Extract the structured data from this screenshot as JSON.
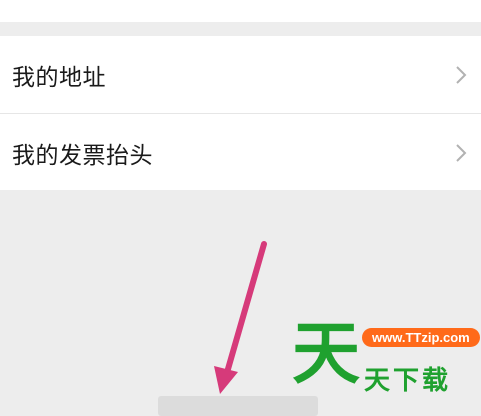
{
  "menu": {
    "items": [
      {
        "label": "我的地址",
        "icon": "chevron-right-icon"
      },
      {
        "label": "我的发票抬头",
        "icon": "chevron-right-icon"
      }
    ]
  },
  "watermark": {
    "big_char": "天",
    "url": "www.TTzip.com",
    "text": "天下载"
  },
  "colors": {
    "page_background": "#ededed",
    "arrow": "#d63a7a",
    "watermark_green": "#1fa12f",
    "watermark_orange": "#ff6a1a"
  }
}
